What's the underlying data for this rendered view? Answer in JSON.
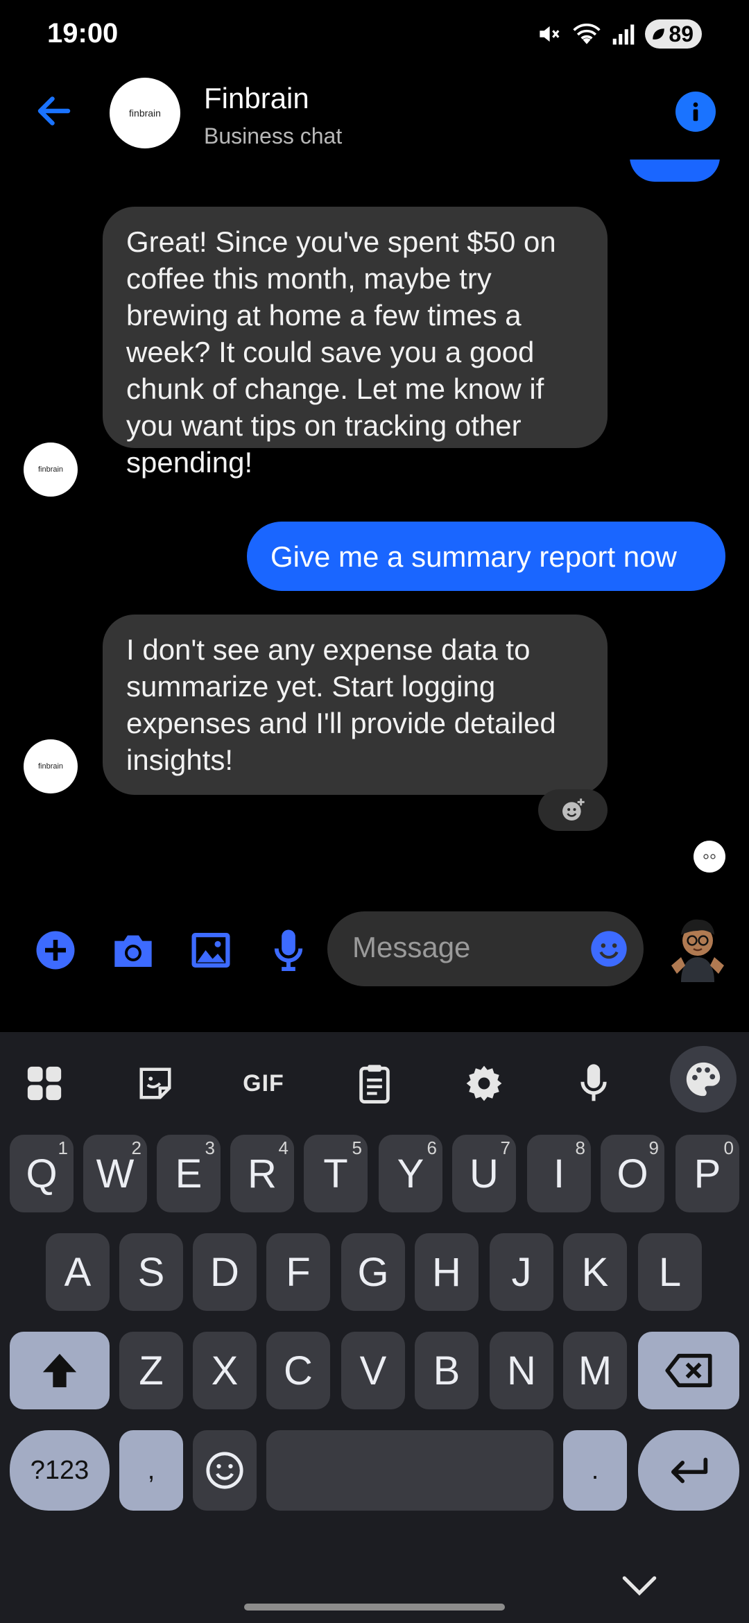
{
  "status_bar": {
    "time": "19:00",
    "battery": "89"
  },
  "header": {
    "title": "Finbrain",
    "subtitle": "Business chat",
    "avatar_text": "finbrain"
  },
  "messages": [
    {
      "from": "bot",
      "text": "Great! Since you've spent $50 on coffee this month, maybe try brewing at home a few times a week? It could save you a good chunk of change. Let me know if you want tips on tracking other spending!"
    },
    {
      "from": "user",
      "text": "Give me a summary report now"
    },
    {
      "from": "bot",
      "text": "I don't see any expense data to summarize yet. Start logging expenses and I'll provide detailed insights!"
    }
  ],
  "composer": {
    "placeholder": "Message"
  },
  "keyboard": {
    "toolbar": {
      "gif": "GIF"
    },
    "row1": [
      {
        "k": "Q",
        "h": "1"
      },
      {
        "k": "W",
        "h": "2"
      },
      {
        "k": "E",
        "h": "3"
      },
      {
        "k": "R",
        "h": "4"
      },
      {
        "k": "T",
        "h": "5"
      },
      {
        "k": "Y",
        "h": "6"
      },
      {
        "k": "U",
        "h": "7"
      },
      {
        "k": "I",
        "h": "8"
      },
      {
        "k": "O",
        "h": "9"
      },
      {
        "k": "P",
        "h": "0"
      }
    ],
    "row2": [
      "A",
      "S",
      "D",
      "F",
      "G",
      "H",
      "J",
      "K",
      "L"
    ],
    "row3": [
      "Z",
      "X",
      "C",
      "V",
      "B",
      "N",
      "M"
    ],
    "symbols": "?123",
    "comma": ",",
    "period": "."
  },
  "colors": {
    "accent": "#1a66ff",
    "incoming_bubble": "#353535",
    "keyboard_bg": "#1c1d22"
  }
}
